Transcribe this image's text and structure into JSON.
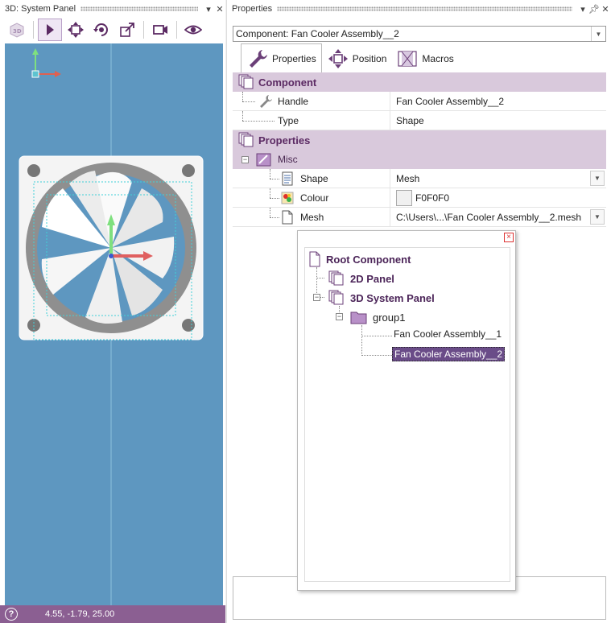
{
  "left_panel": {
    "title": "3D: System Panel",
    "toolbar": [
      "3d-view-icon",
      "select-arrow-icon",
      "move-icon",
      "rotate-icon",
      "scale-icon",
      "camera-icon",
      "eye-icon"
    ],
    "status": {
      "coordinates": "4.55, -1.79, 25.00",
      "help": "?"
    }
  },
  "right_panel": {
    "title": "Properties",
    "component_select": "Component: Fan Cooler Assembly__2",
    "tabs": [
      {
        "label": "Properties"
      },
      {
        "label": "Position"
      },
      {
        "label": "Macros"
      }
    ],
    "grid": {
      "component_header": "Component",
      "handle_label": "Handle",
      "handle_value": "Fan Cooler Assembly__2",
      "type_label": "Type",
      "type_value": "Shape",
      "properties_header": "Properties",
      "misc_label": "Misc",
      "shape_label": "Shape",
      "shape_value": "Mesh",
      "colour_label": "Colour",
      "colour_value": "F0F0F0",
      "colour_swatch": "#F0F0F0",
      "mesh_label": "Mesh",
      "mesh_value": "C:\\Users\\...\\Fan Cooler Assembly__2.mesh"
    }
  },
  "popup_tree": {
    "close": "×",
    "root": "Root Component",
    "panel_2d": "2D Panel",
    "panel_3d": "3D System Panel",
    "group": "group1",
    "item1": "Fan Cooler Assembly__1",
    "item2": "Fan Cooler Assembly__2"
  },
  "colors": {
    "viewport": "#5e97c0",
    "accent": "#8b5f92",
    "category_bg": "#d9c9dc",
    "selection": "#6a4c88"
  }
}
